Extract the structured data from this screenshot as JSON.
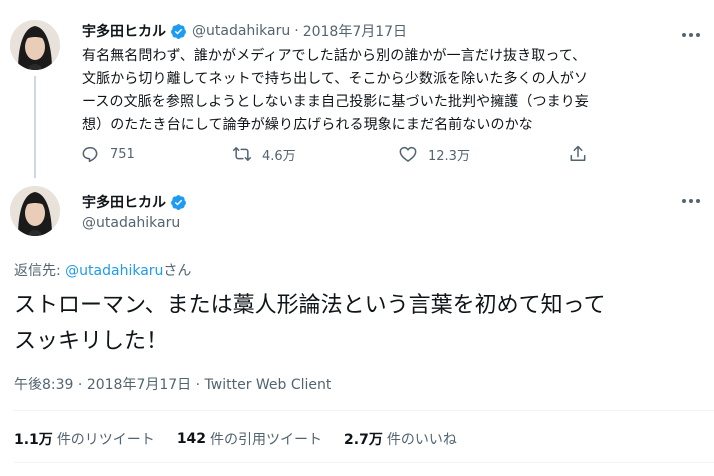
{
  "parent_tweet": {
    "display_name": "宇多田ヒカル",
    "handle": "@utadahikaru",
    "separator": "·",
    "date": "2018年7月17日",
    "text_lines": [
      "有名無名問わず、誰かがメディアでした話から別の誰かが一言だけ抜き取って、",
      "文脈から切り離してネットで持ち出して、そこから少数派を除いた多くの人がソ",
      "ースの文脈を参照しようとしないまま自己投影に基づいた批判や擁護（つまり妄",
      "想）のたたき台にして論争が繰り広げられる現象にまだ名前ないのかな"
    ],
    "actions": {
      "replies": "751",
      "retweets": "4.6万",
      "likes": "12.3万"
    }
  },
  "main_tweet": {
    "display_name": "宇多田ヒカル",
    "handle": "@utadahikaru",
    "reply_prefix": "返信先: ",
    "reply_handle": "@utadahikaru",
    "reply_suffix": "さん",
    "text_lines": [
      "ストローマン、または藁人形論法という言葉を初めて知って",
      "スッキリした！"
    ],
    "time": "午後8:39",
    "separator": "·",
    "date": "2018年7月17日",
    "client": "Twitter Web Client",
    "stats": {
      "retweets_count": "1.1万",
      "retweets_label": "件のリツイート",
      "quotes_count": "142",
      "quotes_label": "件の引用ツイート",
      "likes_count": "2.7万",
      "likes_label": "件のいいね"
    }
  },
  "colors": {
    "accent": "#1d9bf0",
    "text": "#0f1419",
    "secondary": "#536471",
    "divider": "#eff3f4"
  },
  "icons": [
    "avatar",
    "verified-badge-icon",
    "more-icon",
    "reply-icon",
    "retweet-icon",
    "like-icon",
    "share-icon"
  ]
}
